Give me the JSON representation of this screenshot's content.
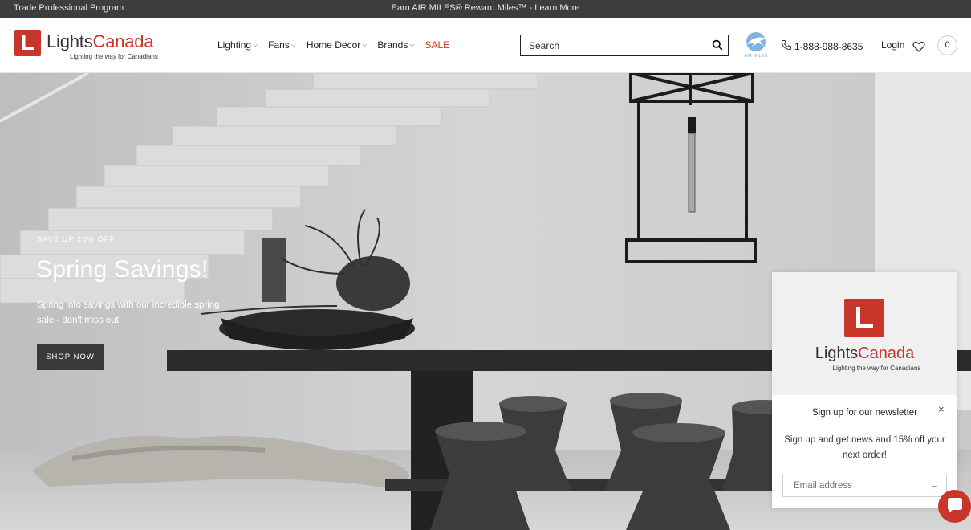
{
  "topbar": {
    "left": "Trade Professional Program",
    "center": "Earn AIR MILES® Reward Miles™ - Learn More"
  },
  "brand": {
    "name_part1": "Lights",
    "name_part2": "Canada",
    "tagline": "Lighting the way for Canadians",
    "accent_color": "#c8362a"
  },
  "nav": {
    "items": [
      {
        "label": "Lighting",
        "chevron": "chevron-down-icon"
      },
      {
        "label": "Fans",
        "chevron": "chevron-down-icon"
      },
      {
        "label": "Home Decor",
        "chevron": "chevron-down-icon"
      },
      {
        "label": "Brands",
        "chevron": "chevron-down-icon"
      }
    ],
    "sale": "SALE",
    "chevron_glyph": "⌵"
  },
  "search": {
    "placeholder": "Search"
  },
  "air_miles": {
    "label": "AIR MILES"
  },
  "header": {
    "phone": "1-888-988-8635",
    "login": "Login",
    "cart_count": "0"
  },
  "hero": {
    "eyebrow": "SAVE UP 20% OFF",
    "title": "Spring Savings!",
    "subtitle": "Spring into savings with our incredible spring sale - don't miss out!",
    "button": "SHOP NOW"
  },
  "newsletter": {
    "brand_part1": "Lights",
    "brand_part2": "Canada",
    "tagline": "Lighting the way for Canadians",
    "close": "×",
    "title": "Sign up for our newsletter",
    "text": "Sign up and get news and 15% off your next order!",
    "email_placeholder": "Email address",
    "submit": "→"
  }
}
